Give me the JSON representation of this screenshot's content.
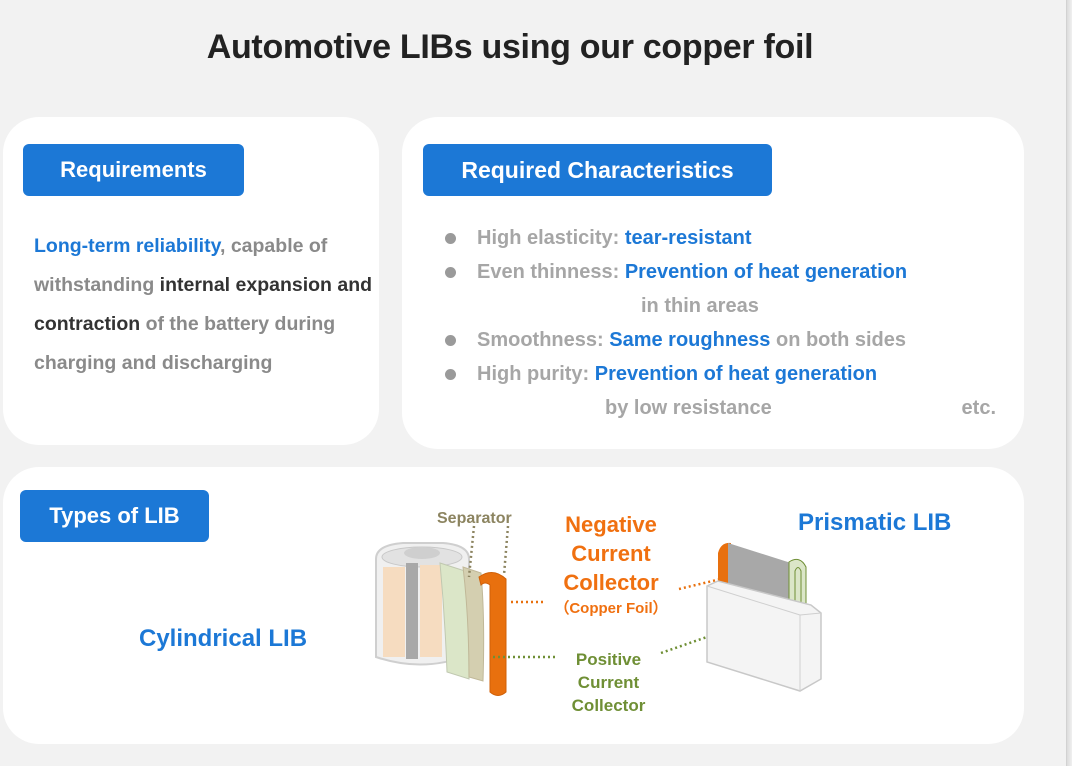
{
  "title": "Automotive LIBs using our copper foil",
  "requirements": {
    "heading": "Requirements",
    "text": {
      "part1": "Long-term reliability",
      "part2": ", capable of withstanding ",
      "part3": "internal expansion and contraction",
      "part4": " of the battery during charging and discharging"
    }
  },
  "characteristics": {
    "heading": "Required Characteristics",
    "items": [
      {
        "label": "High elasticity: ",
        "value": "tear-resistant",
        "suffix": "",
        "continuation": ""
      },
      {
        "label": "Even thinness: ",
        "value": "Prevention of heat generation",
        "suffix": "",
        "continuation": "in thin areas"
      },
      {
        "label": "Smoothness: ",
        "value": "Same roughness",
        "suffix": " on both sides",
        "continuation": ""
      },
      {
        "label": "High purity: ",
        "value": "Prevention of heat generation",
        "suffix": "",
        "continuation": "by low resistance"
      }
    ],
    "etc": "etc."
  },
  "types": {
    "heading": "Types of LIB",
    "cylindrical": "Cylindrical LIB",
    "prismatic": "Prismatic LIB",
    "separator": "Separator",
    "negative": [
      "Negative",
      "Current",
      "Collector"
    ],
    "negative_sub": "（Copper Foil）",
    "positive": [
      "Positive",
      "Current",
      "Collector"
    ]
  },
  "colors": {
    "accent_blue": "#1c78d6",
    "copper_orange": "#f07010",
    "positive_green": "#6f8f35",
    "separator_olive": "#8c8460"
  }
}
